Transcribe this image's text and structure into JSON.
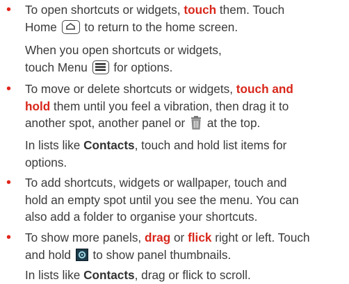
{
  "items": [
    {
      "line1": [
        "To open shortcuts or widgets, ",
        "touch",
        " them. Touch"
      ],
      "line2": [
        "Home",
        " to return to the home screen."
      ],
      "note": [
        "When you open shortcuts or widgets,",
        "touch Menu",
        " for options."
      ]
    },
    {
      "line1": [
        "To move or delete shortcuts or widgets, ",
        "touch and"
      ],
      "line2": [
        "hold",
        " them until you feel a vibration, then drag it to"
      ],
      "line3": [
        "another spot, another panel or",
        " at the top."
      ],
      "note": [
        "In lists like ",
        "Contacts",
        ", touch and hold list items for",
        "options."
      ]
    },
    {
      "lines": [
        "To add shortcuts, widgets or wallpaper, touch and",
        "hold an empty spot until you see the menu. You can",
        "also add a folder to organise your shortcuts."
      ]
    },
    {
      "line1": [
        "To show more panels, ",
        "drag",
        " or ",
        "flick",
        " right or left. Touch"
      ],
      "line2": [
        "and hold",
        " to show panel thumbnails."
      ],
      "note": [
        "In lists like ",
        "Contacts",
        ", drag or flick to scroll."
      ]
    }
  ],
  "bullet_symbol": "•",
  "colors": {
    "accent": "#d8261a",
    "text": "#3a3a3a"
  },
  "icons": [
    "home-icon",
    "menu-icon",
    "trash-icon",
    "panels-icon"
  ]
}
